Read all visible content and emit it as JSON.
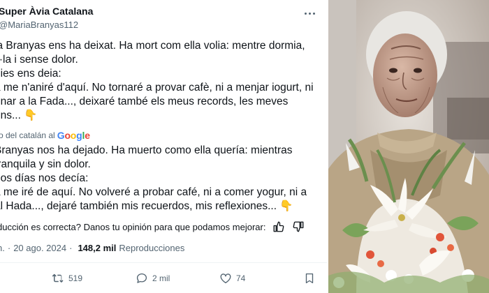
{
  "author": {
    "display_name": "Super Àvia Catalana",
    "handle": "@MariaBranyas112"
  },
  "post": {
    "original_lines": [
      "ia Branyas ens ha deixat. Ha mort com ella volia: mentre dormia,",
      "il·la i sense dolor.",
      "dies ens deia:",
      "a me n'aniré d'aquí. No tornaré a provar cafè, ni a menjar iogurt, ni",
      "onar a la Fada..., deixaré també els meus records, les meves",
      "ons... 👇"
    ],
    "translated_notice": "o del catalán al",
    "translator_brand": "Google",
    "translated_lines": [
      "Branyas nos ha dejado. Ha muerto como ella quería: mientras",
      "tranquila y sin dolor.",
      "nos días nos decía:",
      "a me iré de aquí. No volveré a probar café, ni a comer yogur, ni a",
      "al Hada..., dejaré también mis recuerdos, mis reflexiones... 👇"
    ],
    "feedback_prompt": "ducción es correcta? Danos tu opinión para que podamos mejorar:",
    "time": "n.",
    "date": "20 ago. 2024",
    "views_count": "148,2 mil",
    "views_label": "Reproducciones"
  },
  "actions": {
    "retweets": "519",
    "replies": "2 mil",
    "likes": "74"
  },
  "colors": {
    "text_primary": "#0f1419",
    "text_secondary": "#536471",
    "divider": "#eff3f4"
  },
  "icons": [
    "more-icon",
    "google-logo",
    "thumbs-up-icon",
    "thumbs-down-icon",
    "retweet-icon",
    "reply-icon",
    "like-icon",
    "bookmark-icon"
  ]
}
